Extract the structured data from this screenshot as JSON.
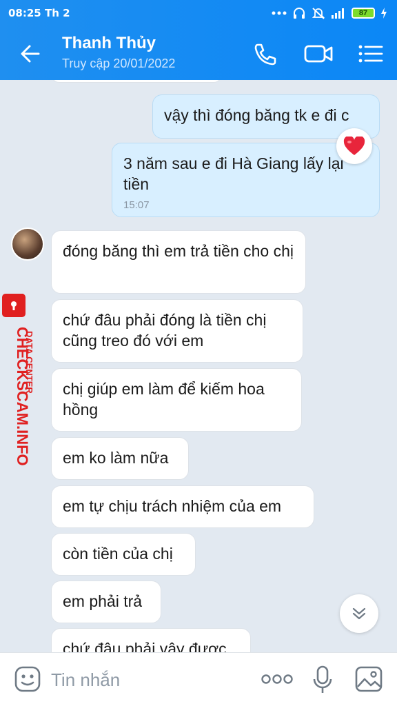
{
  "status_bar": {
    "time": "08:25 Th 2",
    "battery": "87"
  },
  "header": {
    "name": "Thanh Thủy",
    "status": "Truy cập 20/01/2022"
  },
  "messages": [
    {
      "side": "out",
      "text": "vậy thì đóng băng tk e đi c"
    },
    {
      "side": "out",
      "text": "3 năm sau e đi Hà Giang lấy lại tiền",
      "time": "15:07"
    },
    {
      "side": "in",
      "text": "đóng băng thì em trả tiền cho chị"
    },
    {
      "side": "in",
      "text": "chứ đâu phải đóng là tiền chị cũng treo đó với em"
    },
    {
      "side": "in",
      "text": "chị giúp em làm để kiếm hoa hồng"
    },
    {
      "side": "in",
      "text": "em ko làm nữa"
    },
    {
      "side": "in",
      "text": "em tự chịu trách nhiệm của em"
    },
    {
      "side": "in",
      "text": "còn tiền của chị"
    },
    {
      "side": "in",
      "text": "em phải trả"
    },
    {
      "side": "in",
      "text": "chứ đâu phải vậy được"
    }
  ],
  "watermark": {
    "site": "CHECKSCAM.INFO",
    "tag": "DATA CENTER"
  },
  "input": {
    "placeholder": "Tin nhắn"
  },
  "colors": {
    "header": "#1a8cf2",
    "outgoing": "#d8efff",
    "incoming": "#ffffff",
    "background": "#e2e9f1",
    "watermark": "#e02020"
  },
  "icons": [
    "back-arrow-icon",
    "phone-icon",
    "video-camera-icon",
    "menu-list-icon",
    "heart-icon",
    "chevron-double-down-icon",
    "emoji-icon",
    "more-dots-icon",
    "microphone-icon",
    "image-icon"
  ]
}
